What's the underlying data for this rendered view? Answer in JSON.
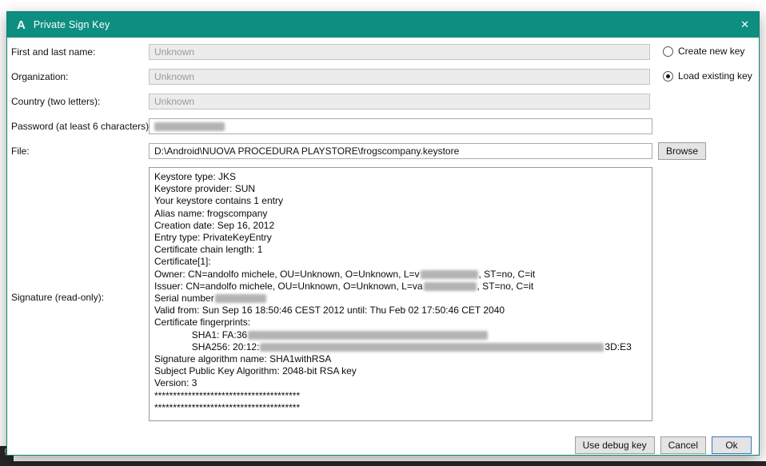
{
  "window": {
    "title": "Private Sign Key",
    "icon_letter": "A",
    "close_glyph": "✕"
  },
  "colors": {
    "titlebar": "#0e8e80",
    "redaction": "#b3b3b3"
  },
  "fields": {
    "name": {
      "label": "First and last name:",
      "value": "Unknown"
    },
    "organization": {
      "label": "Organization:",
      "value": "Unknown"
    },
    "country": {
      "label": "Country (two letters):",
      "value": "Unknown"
    },
    "password": {
      "label": "Password (at least 6 characters):"
    },
    "file": {
      "label": "File:",
      "value": "D:\\Android\\NUOVA PROCEDURA PLAYSTORE\\frogscompany.keystore"
    },
    "signature": {
      "label": "Signature (read-only):"
    }
  },
  "key_mode": [
    {
      "label": "Create new key",
      "selected": false
    },
    {
      "label": "Load existing key",
      "selected": true
    }
  ],
  "signature_lines": [
    "Keystore type: JKS",
    "Keystore provider: SUN",
    "Your keystore contains 1 entry",
    "Alias name: frogscompany",
    "Creation date: Sep 16, 2012",
    "Entry type: PrivateKeyEntry",
    "Certificate chain length: 1",
    "Certificate[1]:",
    "Owner: CN=andolfo michele, OU=Unknown, O=Unknown, L=v[[r:72]], ST=no, C=it",
    "Issuer: CN=andolfo michele, OU=Unknown, O=Unknown, L=va[[r:66]], ST=no, C=it",
    "Serial number[[r:64]]",
    "Valid from: Sun Sep 16 18:50:46 CEST 2012 until: Thu Feb 02 17:50:46 CET 2040",
    "Certificate fingerprints:",
    "\tSHA1: FA:36[[r:300]]",
    "\tSHA256: 20:12:[[r:430]]3D:E3",
    "Signature algorithm name: SHA1withRSA",
    "Subject Public Key Algorithm: 2048-bit RSA key",
    "Version: 3",
    "***************************************",
    "***************************************"
  ],
  "buttons": {
    "browse": "Browse",
    "use_debug": "Use debug key",
    "cancel": "Cancel",
    "ok": "Ok"
  },
  "background": {
    "stray_glyph": "g"
  }
}
